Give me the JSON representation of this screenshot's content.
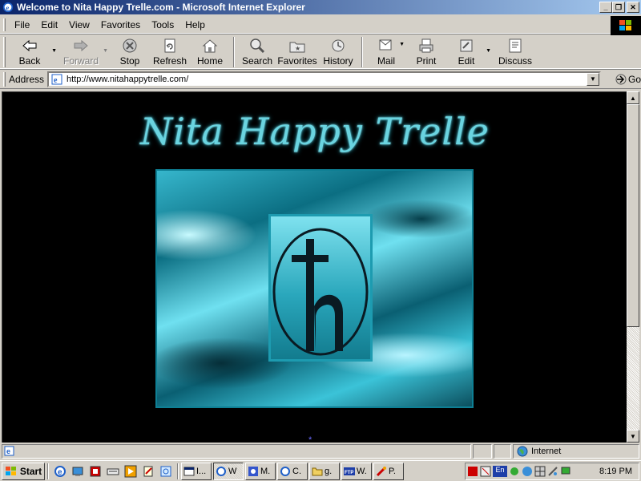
{
  "window": {
    "title": "Welcome to Nita Happy Trelle.com - Microsoft Internet Explorer",
    "caption_buttons": [
      "minimize",
      "restore",
      "close"
    ]
  },
  "menu": {
    "items": [
      {
        "label": "File"
      },
      {
        "label": "Edit"
      },
      {
        "label": "View"
      },
      {
        "label": "Favorites"
      },
      {
        "label": "Tools"
      },
      {
        "label": "Help"
      }
    ]
  },
  "toolbar": {
    "back": "Back",
    "forward": "Forward",
    "stop": "Stop",
    "refresh": "Refresh",
    "home": "Home",
    "search": "Search",
    "favorites": "Favorites",
    "history": "History",
    "mail": "Mail",
    "print": "Print",
    "edit": "Edit",
    "discuss": "Discuss"
  },
  "address": {
    "label": "Address",
    "url": "http://www.nitahappytrelle.com/",
    "go_label": "Go"
  },
  "page": {
    "heading": "Nita Happy Trelle",
    "bullet": "*"
  },
  "status": {
    "text": "",
    "zone": "Internet"
  },
  "taskbar": {
    "start_label": "Start",
    "tasks": [
      {
        "label": "I..."
      },
      {
        "label": "W"
      },
      {
        "label": "M."
      },
      {
        "label": "C."
      },
      {
        "label": "g."
      },
      {
        "label": "W."
      },
      {
        "label": "P."
      }
    ],
    "tray_lang": "En",
    "clock": "8:19 PM"
  },
  "colors": {
    "title_gradient_start": "#0a246a",
    "title_gradient_end": "#a6caf0",
    "page_background": "#000000",
    "heading_color": "#6ad4e0"
  }
}
